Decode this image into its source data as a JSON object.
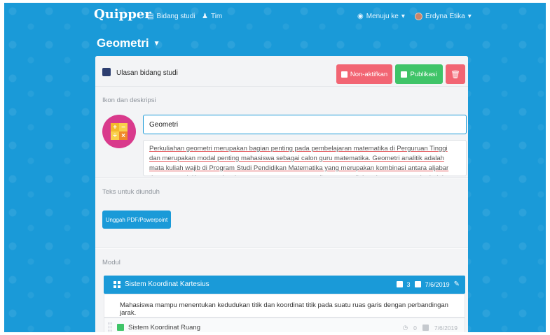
{
  "app": {
    "logo": "Quipper"
  },
  "nav": {
    "bidang_studi": "Bidang studi",
    "tim": "Tim",
    "menuju_ke": "Menuju ke",
    "user_name": "Erdyna Etika"
  },
  "page": {
    "title": "Geometri"
  },
  "header": {
    "review_label": "Ulasan bidang studi",
    "nonaktif_label": "Non-aktifkan",
    "publikasi_label": "Publikasi"
  },
  "ikon": {
    "section_label": "Ikon dan deskripsi",
    "title_value": "Geometri",
    "description": "Perkuliahan geometri merupakan bagian penting pada pembelajaran matematika di Perguruan Tinggi dan merupakan modal penting mahasiswa sebagai calon guru matematika. Geometri analitik adalah mata kuliah wajib di Program Studi Pendidikan Matematika yang merupakan kombinasi antara aljabar dan geometri. Korespondensi antara persamaan matematika secara aljabar dengan tempat kedudukan secara geometri dan dipadukan suatu metode pemecahan"
  },
  "teks": {
    "section_label": "Teks untuk diunduh",
    "upload_label": "Unggah PDF/Powerpoint"
  },
  "modul": {
    "section_label": "Modul",
    "items": [
      {
        "title": "Sistem Koordinat Kartesius",
        "count": "3",
        "date": "7/6/2019",
        "description": "Mahasiswa mampu menentukan kedudukan titik dan koordinat titik pada  suatu ruas garis dengan perbandingan jarak."
      },
      {
        "title": "Sistem Koordinat Ruang",
        "count": "0",
        "date": "7/6/2019"
      }
    ]
  },
  "colors": {
    "background": "#1a9ad8",
    "danger": "#f26573",
    "success": "#3fc468",
    "primary": "#1a9ad8"
  }
}
